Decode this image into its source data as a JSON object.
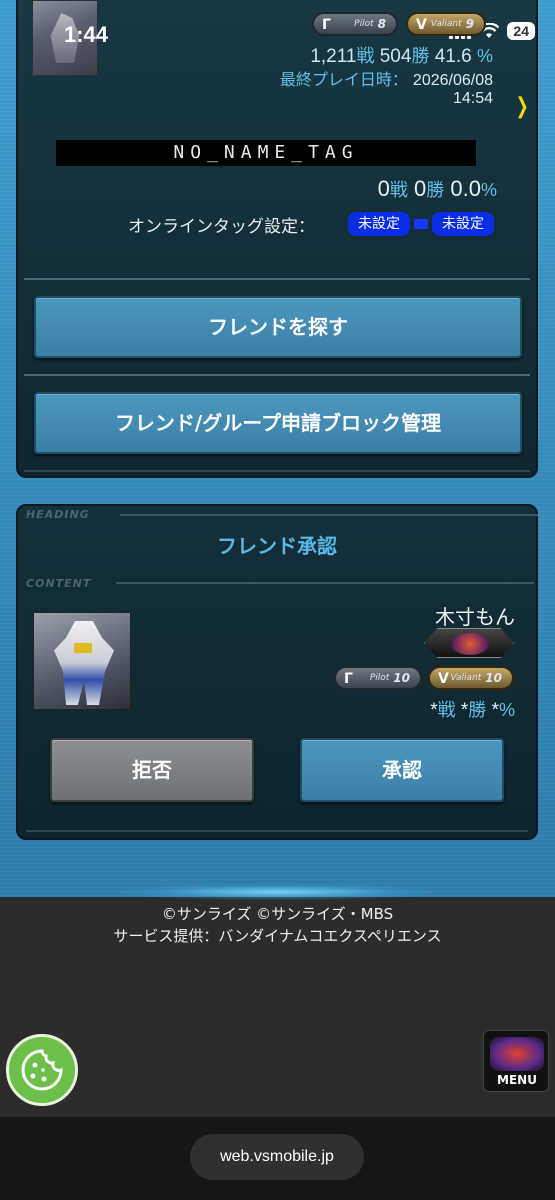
{
  "status_bar": {
    "time": "1:44",
    "battery": "24"
  },
  "profile": {
    "pilot_badge": {
      "mark": "Г",
      "label": "Pilot",
      "grade": "8"
    },
    "valiant_badge": {
      "mark": "V",
      "label": "Valiant",
      "grade": "9"
    },
    "battles": "1,211",
    "battles_unit": "戦",
    "wins": "504",
    "wins_unit": "勝",
    "win_rate": "41.6",
    "percent_unit": "%",
    "last_play_label": "最終プレイ日時：",
    "last_play_date": "2026/06/08",
    "last_play_time": "14:54"
  },
  "tag": {
    "name": "NO_NAME_TAG",
    "battles": "0",
    "battles_unit": "戦",
    "wins": "0",
    "wins_unit": "勝",
    "win_rate": "0.0",
    "percent_unit": "%",
    "online_label": "オンラインタッグ設定：",
    "setting_1": "未設定",
    "setting_2": "未設定"
  },
  "buttons": {
    "find_friend": "フレンドを探す",
    "block_manage": "フレンド/グループ申請ブロック管理"
  },
  "friend_request": {
    "heading_tag": "HEADING",
    "title": "フレンド承認",
    "content_tag": "CONTENT",
    "name": "木寸もん",
    "pilot_badge": {
      "mark": "Г",
      "label": "Pilot",
      "grade": "10"
    },
    "valiant_badge": {
      "mark": "V",
      "label": "Valiant",
      "grade": "10"
    },
    "battles": "*",
    "battles_unit": "戦",
    "wins": "*",
    "wins_unit": "勝",
    "win_rate": "*",
    "percent_unit": "%",
    "reject_label": "拒否",
    "accept_label": "承認"
  },
  "footer": {
    "copyright": "©サンライズ ©サンライズ・MBS",
    "provider": "サービス提供：バンダイナムコエクスペリエンス",
    "menu_label": "MENU"
  },
  "browser": {
    "url": "web.vsmobile.jp"
  },
  "colors": {
    "accent": "#5fc0e8",
    "button": "#4c97bf",
    "reject": "#8d8f92",
    "tag_pill": "#0a2de6"
  },
  "icons": [
    "signal-icon",
    "wifi-icon",
    "battery-icon",
    "chevron-right-icon",
    "cookie-icon",
    "menu-logo-icon"
  ]
}
